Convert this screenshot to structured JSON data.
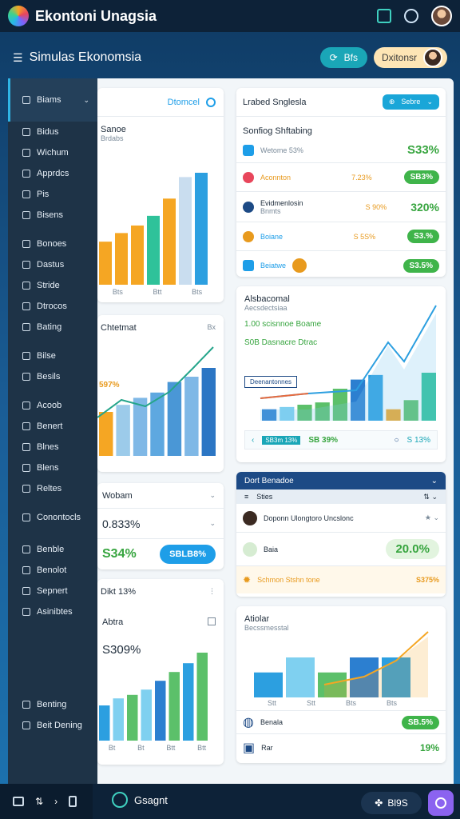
{
  "app": {
    "title": "Ekontoni Unagsia"
  },
  "subheader": {
    "title": "Simulas Ekonomsia",
    "teal_pill": "Bfs",
    "yellow_pill": "Dxitonsr"
  },
  "sidebar": {
    "items": [
      {
        "label": "Biams",
        "active": true
      },
      {
        "label": "Bidus"
      },
      {
        "label": "Wichum"
      },
      {
        "label": "Apprdcs"
      },
      {
        "label": "Pis"
      },
      {
        "label": "Bisens"
      },
      {
        "label": "Bonoes"
      },
      {
        "label": "Dastus"
      },
      {
        "label": "Stride"
      },
      {
        "label": "Dtrocos"
      },
      {
        "label": "Bating"
      },
      {
        "label": "Bilse"
      },
      {
        "label": "Besils"
      },
      {
        "label": "Acoob"
      },
      {
        "label": "Benert"
      },
      {
        "label": "Blnes"
      },
      {
        "label": "Blens"
      },
      {
        "label": "Reltes"
      },
      {
        "label": "Conontocls"
      },
      {
        "label": "Benble"
      },
      {
        "label": "Benolot"
      },
      {
        "label": "Sepnert"
      },
      {
        "label": "Asinibtes"
      },
      {
        "label": "Benting"
      },
      {
        "label": "Beit Dening"
      }
    ]
  },
  "left_col": {
    "card1": {
      "header": "Dtomcel",
      "title": "Sanoe",
      "sub": "Brdabs",
      "ticks": [
        "Bts",
        "Btt",
        "Bts"
      ]
    },
    "card2": {
      "title": "Chtetmat",
      "sub": "Bx",
      "label_pct": "597%"
    },
    "card3": {
      "title": "Wobam",
      "pct": "0.833%",
      "value": "S34%",
      "button": "SBLB8%"
    },
    "card4": {
      "title": "Dikt 13%",
      "name": "Abtra",
      "value": "S309%",
      "ticks": [
        "Bt",
        "Bt",
        "Btt",
        "Btt"
      ]
    }
  },
  "right_col": {
    "card1": {
      "title": "Lrabed Snglesla",
      "dropdown": "Sebre",
      "heading": "Sonfiog Shftabing",
      "rows": [
        {
          "name": "Wetome 53%",
          "value": "S33%"
        },
        {
          "name": "Aconnton",
          "mid": "7.23%",
          "pill": "SB3%"
        },
        {
          "name": "Evidmenlosin",
          "sub": "Bnmts",
          "mid": "S 90%",
          "value": "320%"
        },
        {
          "name": "Boiane",
          "mid": "S 5S%",
          "pill": "S3.%"
        },
        {
          "name": "Beiatwe",
          "pill": "S3.5%"
        }
      ]
    },
    "card2": {
      "title": "Alsbacomal",
      "sub": "Aecsdectsiaa",
      "line1": "1.00 scisnnoe Boame",
      "line2": "S0B Dasnacre Dtrac",
      "box": "Deenantonnes",
      "footer_a": "SB3m 13%",
      "footer_b": "SB 39%",
      "footer_c": "S 13%"
    },
    "card3": {
      "header": "Dort Benadoe",
      "sub_header": "Sties",
      "row1": "Doponn Ulongtoro Uncslonc",
      "row2_name": "Baia",
      "row2_value": "20.0%",
      "row3_name": "Schmon Stshn tone",
      "row3_value": "S375%"
    },
    "card4": {
      "title": "Atiolar",
      "sub": "Becssmesstal",
      "ticks": [
        "Stt",
        "Stt",
        "Bts",
        "Bts"
      ],
      "row1_name": "Benala",
      "row1_pill": "SB.5%",
      "row2_name": "Rar",
      "row2_value": "19%"
    }
  },
  "bottombar": {
    "app_label": "Gsagnt",
    "pill_label": "Bl9S"
  },
  "chart_data": [
    {
      "type": "bar",
      "title": "Sanoe",
      "values": [
        40,
        48,
        55,
        64,
        80,
        100,
        104
      ]
    },
    {
      "type": "bar",
      "title": "Chtetmat",
      "values": [
        50,
        58,
        66,
        72,
        84,
        90,
        100
      ]
    },
    {
      "type": "bar",
      "title": "Abtra",
      "values": [
        40,
        48,
        52,
        58,
        68,
        78,
        88,
        100
      ]
    },
    {
      "type": "bar",
      "title": "Alsbacomal",
      "values": [
        10,
        12,
        14,
        16,
        28,
        36,
        40,
        10,
        18,
        42
      ]
    },
    {
      "type": "bar",
      "title": "Atiolar",
      "values": [
        30,
        48,
        30,
        48,
        48
      ]
    }
  ],
  "colors": {
    "accent": "#1e9ee8",
    "green": "#3fb44a",
    "orange": "#e89a1e",
    "navy": "#1d4a85"
  }
}
